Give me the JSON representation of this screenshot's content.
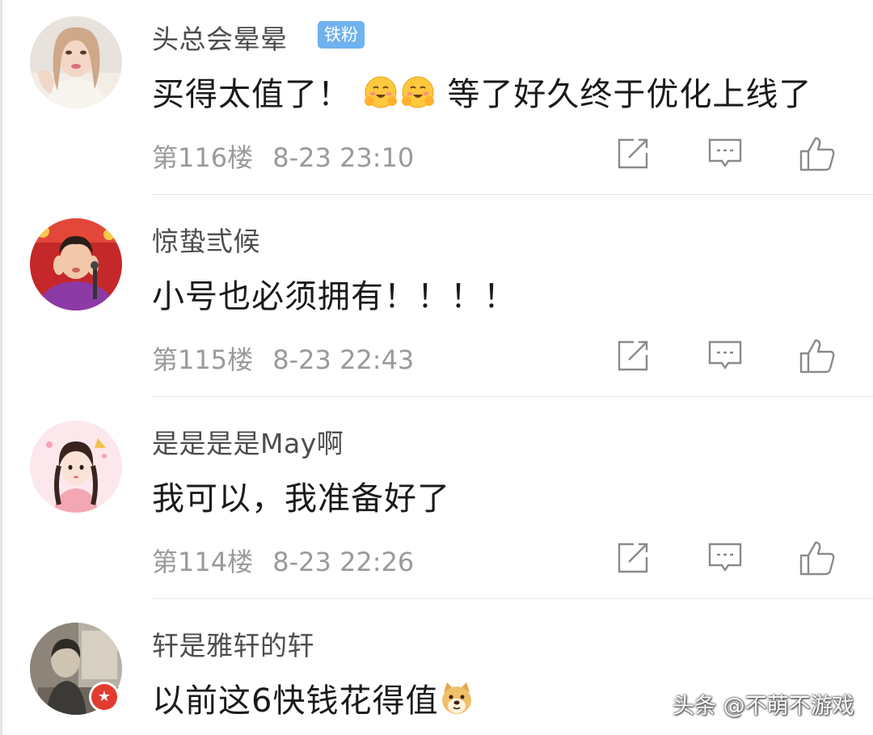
{
  "comments": [
    {
      "username": "头总会晕晕",
      "badge": "铁粉",
      "text_before": "买得太值了！",
      "text_after": "等了好久终于优化上线了",
      "floor": "第116楼",
      "time": "8-23 23:10"
    },
    {
      "username": "惊蛰弎候",
      "text": "小号也必须拥有！！！！",
      "floor": "第115楼",
      "time": "8-23 22:43"
    },
    {
      "username": "是是是是May啊",
      "text": "我可以，我准备好了",
      "floor": "第114楼",
      "time": "8-23 22:26"
    },
    {
      "username": "轩是雅轩的轩",
      "text": "以前这6快钱花得值",
      "floor": "",
      "time": ""
    }
  ],
  "icons": {
    "share": "share-edit-icon",
    "reply": "reply-comment-icon",
    "like": "thumbs-up-icon",
    "emoji_hug": "hugging-face-emoji",
    "emoji_doge": "doge-emoji"
  },
  "watermark": "头条 @不萌不游戏",
  "colors": {
    "badge": "#6fb2ee",
    "username": "#4d4d4d",
    "meta": "#9a9a9a",
    "icon": "#8a8a8a"
  }
}
